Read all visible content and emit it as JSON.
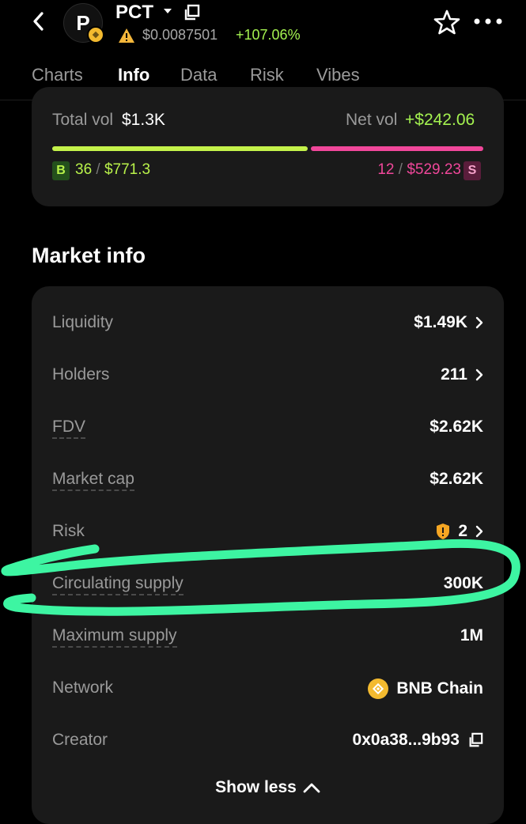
{
  "header": {
    "avatar_letter": "P",
    "ticker": "PCT",
    "price": "$0.0087501",
    "change": "+107.06%"
  },
  "tabs": [
    {
      "label": "Charts"
    },
    {
      "label": "Info"
    },
    {
      "label": "Data"
    },
    {
      "label": "Risk"
    },
    {
      "label": "Vibes"
    }
  ],
  "volume": {
    "total_label": "Total vol",
    "total_value": "$1.3K",
    "net_label": "Net vol",
    "net_value": "+$242.06",
    "buy_tag": "B",
    "buy_count": "36",
    "buy_amount": "$771.3",
    "sell_tag": "S",
    "sell_count": "12",
    "sell_amount": "$529.23",
    "buy_fraction": 0.593
  },
  "market_info": {
    "title": "Market info",
    "rows": [
      {
        "label": "Liquidity",
        "value": "$1.49K"
      },
      {
        "label": "Holders",
        "value": "211"
      },
      {
        "label": "FDV",
        "value": "$2.62K"
      },
      {
        "label": "Market cap",
        "value": "$2.62K"
      },
      {
        "label": "Risk",
        "value": "2"
      },
      {
        "label": "Circulating supply",
        "value": "300K"
      },
      {
        "label": "Maximum supply",
        "value": "1M"
      },
      {
        "label": "Network",
        "value": "BNB Chain"
      },
      {
        "label": "Creator",
        "value": "0x0a38...9b93"
      }
    ],
    "show_less": "Show less"
  },
  "colors": {
    "positive": "#a4f250",
    "buy_bar": "#c4f24a",
    "sell": "#f0479a",
    "annotation": "#3df5a2",
    "bnb": "#f3ba2f"
  }
}
